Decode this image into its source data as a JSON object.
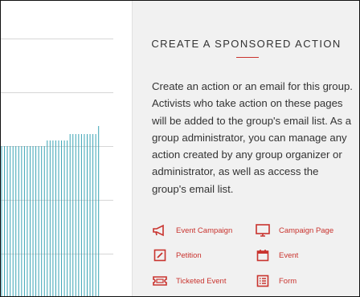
{
  "panel": {
    "title": "CREATE A SPONSORED ACTION",
    "description": "Create an action or an email for this group. Activists who take action on these pages will be added to the group's email list. As a group administrator, you can manage any action created by any group organizer or administrator, as well as access the group's email list.",
    "actions": [
      {
        "label": "Event Campaign",
        "icon": "megaphone-icon"
      },
      {
        "label": "Campaign Page",
        "icon": "monitor-icon"
      },
      {
        "label": "Petition",
        "icon": "edit-icon"
      },
      {
        "label": "Event",
        "icon": "calendar-icon"
      },
      {
        "label": "Ticketed Event",
        "icon": "ticket-icon"
      },
      {
        "label": "Form",
        "icon": "form-icon"
      }
    ]
  },
  "colors": {
    "accent": "#c9332e",
    "bar": "#3aa3b4"
  }
}
